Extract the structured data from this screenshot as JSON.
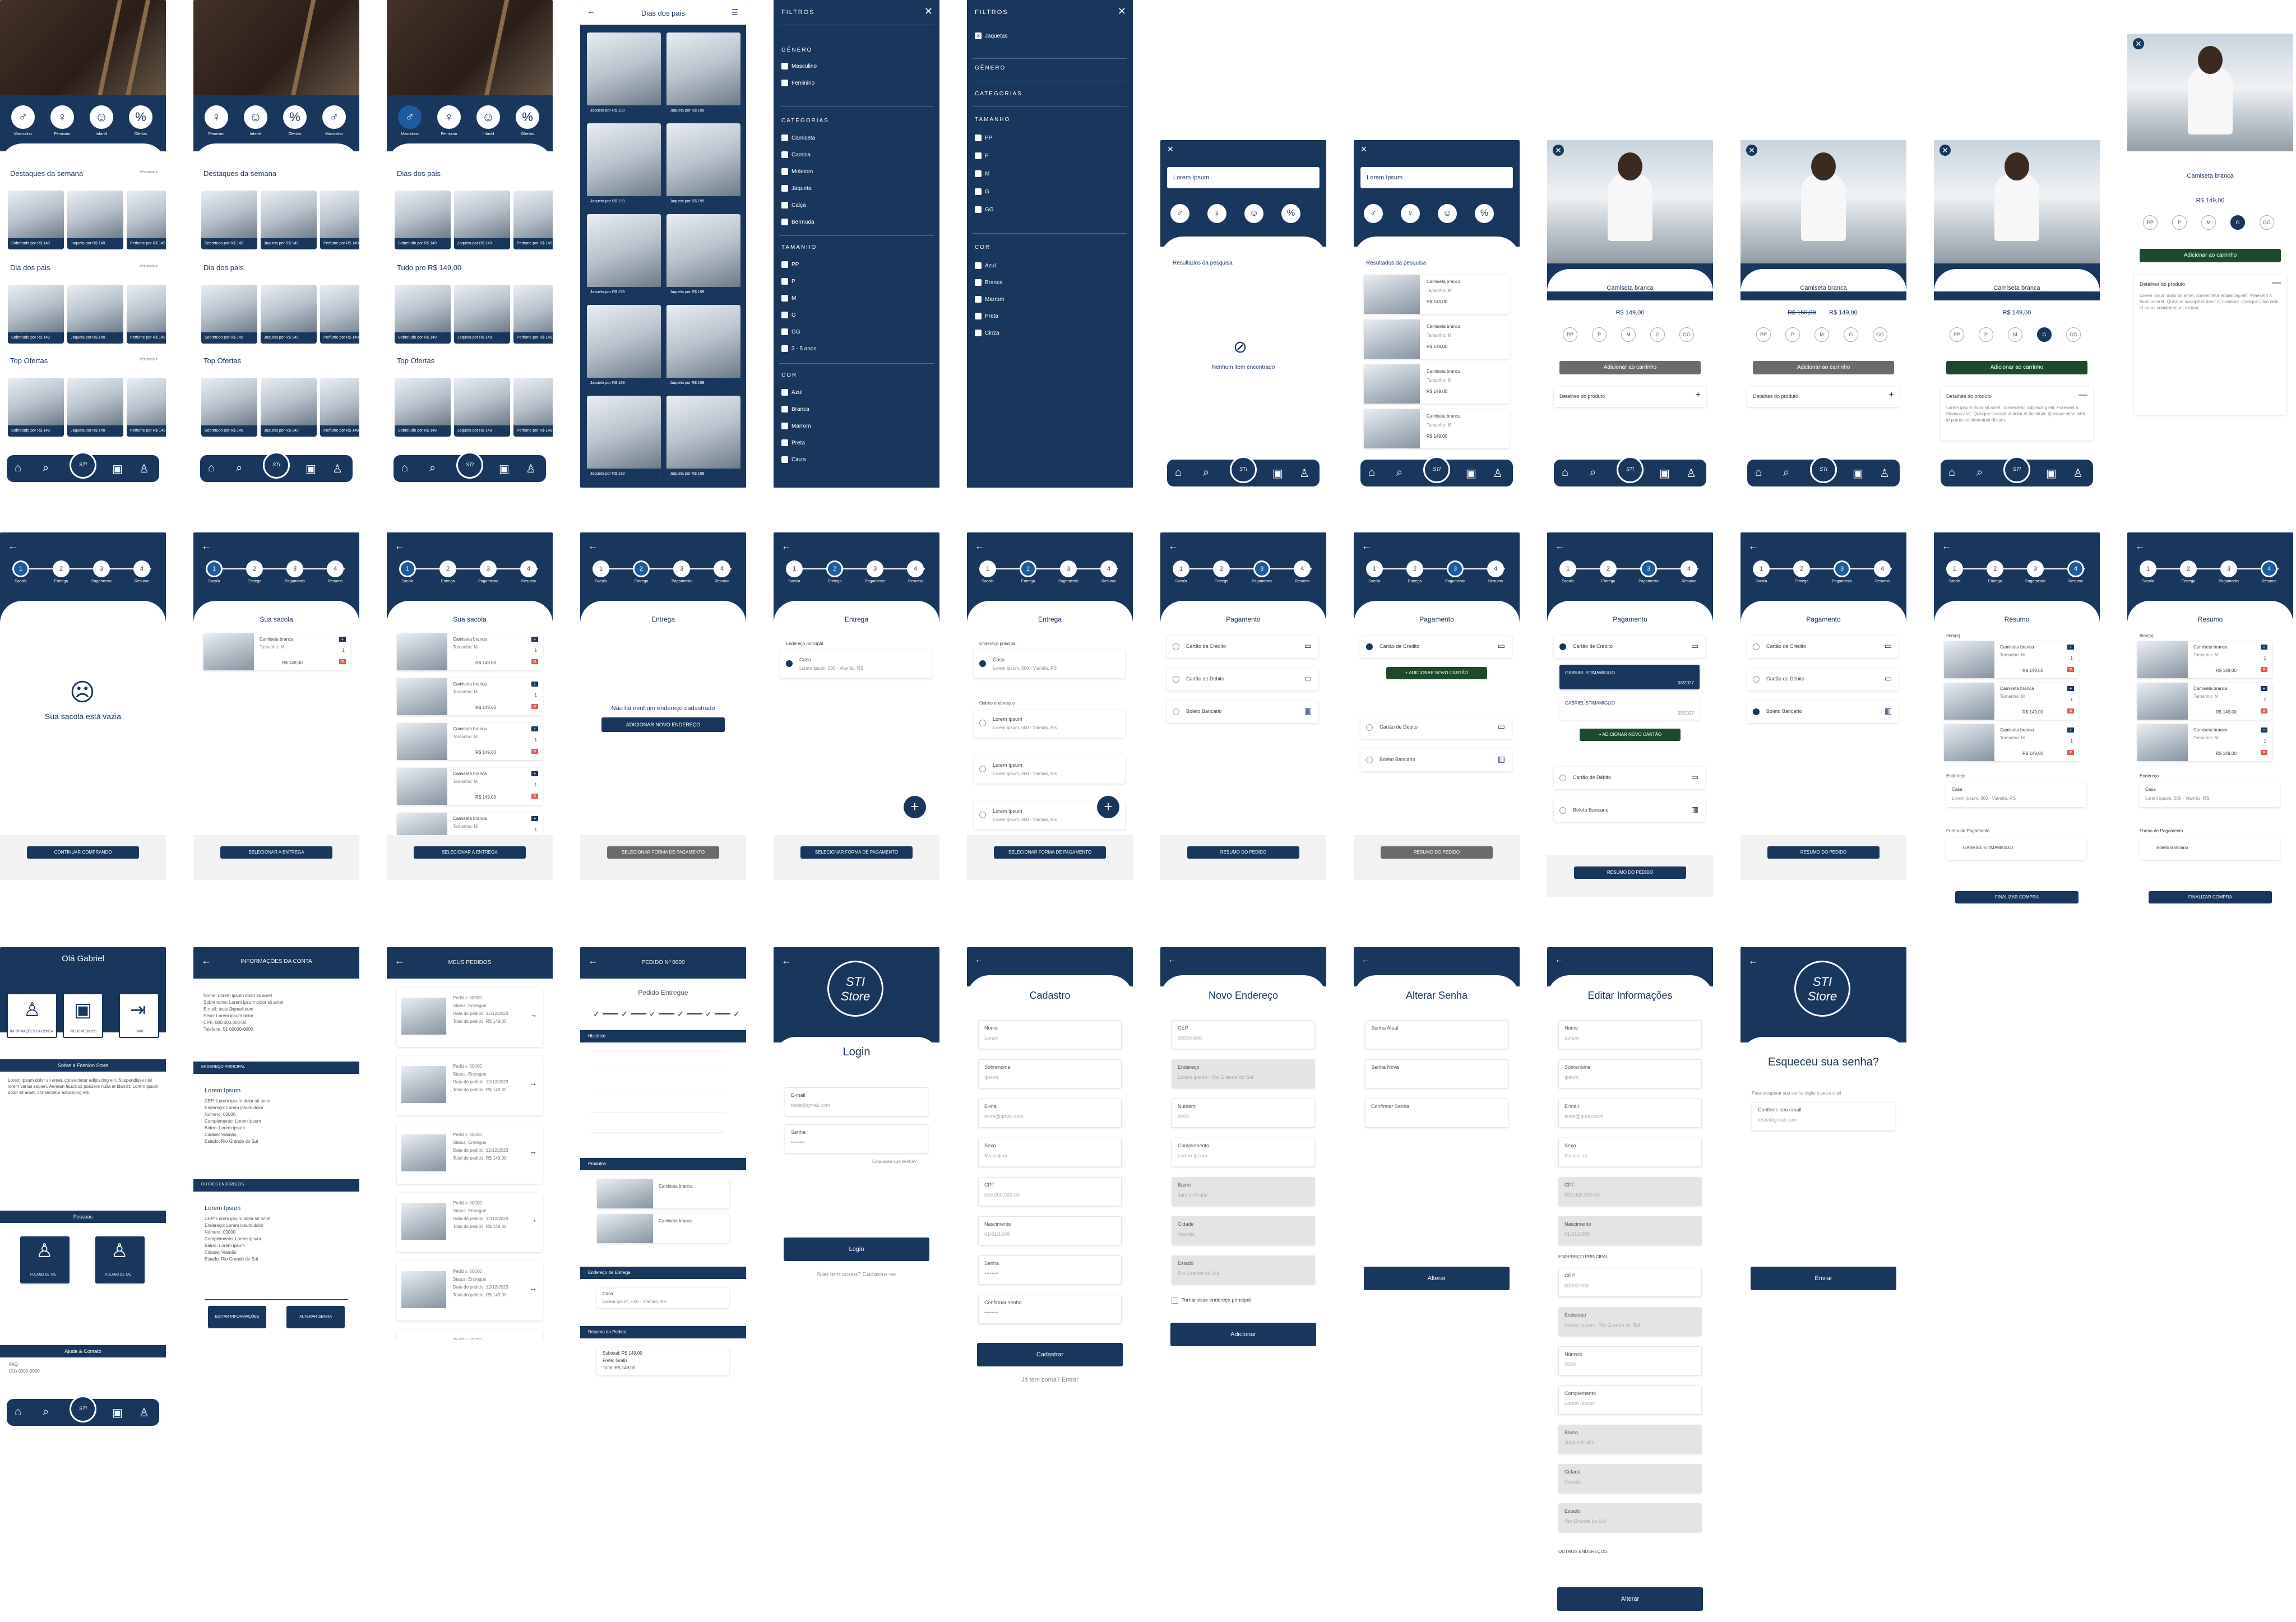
{
  "brand": {
    "logo_line1": "STI",
    "logo_line2": "Store"
  },
  "home": {
    "categories": [
      "Masculino",
      "Feminino",
      "Infantil",
      "Ofertas"
    ],
    "sections": [
      "Destaques da semana",
      "Dia dos pais",
      "Top Ofertas"
    ],
    "sections_b": [
      "Dias dos pais",
      "Tudo pro R$ 149,00",
      "Top Ofertas"
    ],
    "see_all": "Ver mais >",
    "product_captions": [
      "Sobretudo por R$ 149",
      "Jaqueta por R$ 149",
      "Perfume por R$ 149"
    ],
    "dots": "• • •"
  },
  "listing": {
    "title": "Dias dos pais",
    "caption": "Jaqueta por R$ 199"
  },
  "filters": {
    "title": "FILTROS",
    "genero": "GÊNERO",
    "genero_opts": [
      "Masculino",
      "Feminino"
    ],
    "categorias": "CATEGORIAS",
    "cat_opts": [
      "Camiseta",
      "Camisa",
      "Moletom",
      "Jaqueta",
      "Calça",
      "Bermuda"
    ],
    "tamanho": "TAMANHO",
    "size_opts": [
      "PP",
      "P",
      "M",
      "G",
      "GG",
      "3 - 5 anos"
    ],
    "cor": "COR",
    "color_opts": [
      "Azul",
      "Branca",
      "Marrom",
      "Preta",
      "Cinza"
    ],
    "selected": "Jaquetas"
  },
  "search": {
    "placeholder": "Lorem Ipsum",
    "results": "Resultados da pesquisa",
    "empty": "Nenhum item encontrado",
    "item_name": "Camiseta branca",
    "item_size": "Tamanho: M",
    "item_price": "R$ 149,00"
  },
  "product": {
    "name": "Camiseta branca",
    "price": "R$ 149,00",
    "old_price": "R$ 160,00",
    "sizes": [
      "PP",
      "P",
      "M",
      "G",
      "GG"
    ],
    "add": "Adicionar ao carrinho",
    "details": "Detalhes do produto",
    "desc": "Lorem ipsum dolor sit amet, consectetur adipiscing elit. Praesent a thoncus erat. Quisque suscipit et dolor et tincidunt. Quisque vitae nibh id purus condimentum dictum."
  },
  "checkout": {
    "steps": [
      "Sacola",
      "Entrega",
      "Pagamento",
      "Resumo"
    ],
    "empty_bag": "Sua sacola está vazia",
    "continue": "CONTINUAR COMPRANDO",
    "bag_title": "Sua sacola",
    "bag_item": "Camiseta branca",
    "bag_size": "Tamanho: M",
    "bag_qty": "1",
    "bag_price": "R$ 149,00",
    "to_delivery": "SELECIONAR A ENTREGA",
    "delivery_title": "Entrega",
    "no_address": "Não há nenhum endereço cadastrado",
    "add_address": "ADICIONAR NOVO ENDEREÇO",
    "main_address": "Endereço principal",
    "home": "Casa",
    "address": "Lorem Ipsum, 000 - Viamão, RS",
    "other_addresses": "Outros endereços",
    "other_name": "Lorem Ipsum",
    "to_payment": "SELECIONAR FORMA DE PAGAMENTO",
    "payment_title": "Pagamento",
    "credit": "Cartão de Crédito",
    "debit": "Cartão de Débito",
    "boleto": "Boleto Bancario",
    "add_card": "+ ADICIONAR NOVO CARTÃO",
    "card_holder": "GABRIEL STIMAMIGLIO",
    "card_exp": "03/2027",
    "to_summary": "RESUMO DO PEDIDO",
    "summary_title": "Resumo",
    "items": "Item(s)",
    "endereco": "Endereço",
    "forma": "Forma de Pagamento",
    "finish": "FINALIZAR COMPRA"
  },
  "account": {
    "hello": "Olá Gabriel",
    "tiles": [
      "INFORMAÇÕES DA CONTA",
      "MEUS PEDIDOS",
      "SAIR"
    ],
    "about_title": "Sobre a Fashion Store",
    "about_text": "Lorem ipsum dolor sit amet, consectetur adipiscing elit. Suspendisse nisi lorem varius sapien. Aenean faucibus posuere nulla at blandit. Lorem ipsum dolor sit amet, consectetur adipiscing elit.",
    "people": "Pessoas",
    "person": "FULANO DE TAL",
    "help": "Ajuda & Contato",
    "faq": "FAQ",
    "phone": "(51) 0000-0000"
  },
  "info": {
    "title": "INFORMAÇÕES DA CONTA",
    "lines": [
      "Nome: Lorem ipsum dolor sit amet",
      "Sobrenome: Lorem ipsum dolor sit amet",
      "E-mail: teste@gmail.com",
      "Sexo: Lorem ipsum dolor",
      "CPF: 000.000.000-00",
      "Telefone: 51 00000-0000"
    ],
    "main_address": "ENDEREÇO PRINCIPAL",
    "other_address": "OUTROS ENDEREÇOS",
    "addr_title": "Lorem Ipsum",
    "addr_lines": [
      "CEP: Lorem ipsum dolor sit amet",
      "Endereço: Lorem ipsum dolor",
      "Número: 00000",
      "Complemento: Lorem ipsum",
      "Bairro: Lorem ipsum",
      "Cidade: Viamão",
      "Estado: Rio Grande do Sul"
    ],
    "edit": "EDITAR INFORMAÇÕES",
    "change_pw": "ALTERAR SENHA"
  },
  "orders": {
    "title": "MEUS PEDIDOS",
    "lines": [
      "Pedido: 00000",
      "Status: Entregue",
      "Data do pedido: 12/12/2023",
      "Total do pedido: R$ 149,00"
    ]
  },
  "order": {
    "title": "PEDIDO Nº 0000",
    "status": "Pedido Entregue",
    "history": "Histórico",
    "products": "Produtos",
    "delivery": "Endereço de Entrega",
    "summary": "Resumo do Pedido",
    "totals": [
      "Subtotal: R$ 149,00",
      "Frete: Grátis",
      "Total: R$ 149,00"
    ]
  },
  "login": {
    "title": "Login",
    "email": "E-mail",
    "email_ph": "teste@gmail.com",
    "pw": "Senha",
    "forgot": "Esqueceu sua senha?",
    "btn": "Login",
    "no_account": "Não tem conta? Cadastre-se"
  },
  "signup": {
    "title": "Cadastro",
    "fields": [
      "Nome",
      "Sobrenome",
      "E-mail",
      "Sexo",
      "CPF",
      "Nascimento",
      "Senha",
      "Confirmar senha"
    ],
    "values": [
      "Lorem",
      "Ipsum",
      "teste@gmail.com",
      "Masculino",
      "000.000.000-00",
      "01/01/1998",
      "••••••••",
      "••••••••"
    ],
    "btn": "Cadastrar",
    "have": "Já tem conta? Entrar"
  },
  "new_address": {
    "title": "Novo Endereço",
    "fields": [
      "CEP",
      "Endereço",
      "Número",
      "Complemento",
      "Bairro",
      "Cidade",
      "Estado"
    ],
    "values": [
      "00000-000",
      "Lorem Ipsum - Rio Grande do Sul",
      "0000",
      "Lorem Ipsum",
      "Jardim Krahe",
      "Viamão",
      "Rio Grande do Sul"
    ],
    "main": "Tornar esse endereço principal",
    "btn": "Adicionar"
  },
  "change_pw": {
    "title": "Alterar Senha",
    "fields": [
      "Senha Atual",
      "Senha Nova",
      "Confirmar Senha"
    ],
    "btn": "Alterar"
  },
  "edit_info": {
    "title": "Editar Informações",
    "fields": [
      "Nome",
      "Sobrenome",
      "E-mail",
      "Sexo",
      "CPF",
      "Nascimento"
    ],
    "values": [
      "Lorem",
      "Ipsum",
      "teste@gmail.com",
      "Masculino",
      "000.000.000-00",
      "01/01/1998"
    ],
    "main_addr": "ENDEREÇO PRINCIPAL",
    "addr_fields": [
      "CEP",
      "Endereço",
      "Número",
      "Complemento",
      "Bairro",
      "Cidade",
      "Estado"
    ],
    "addr_values": [
      "00000-000",
      "Lorem Ipsum - Rio Grande do Sul",
      "0000",
      "Lorem Ipsum",
      "Jardim Krahe",
      "Viamão",
      "Rio Grande do Sul"
    ],
    "others": "OUTROS ENDEREÇOS",
    "btn": "Alterar"
  },
  "forgot": {
    "title": "Esqueceu sua senha?",
    "hint": "Para recuperar sua senha digite o seu e-mail",
    "field": "Confirme seu email",
    "value": "teste@gmail.com",
    "btn": "Enviar"
  },
  "colors": {
    "navy": "#19365c",
    "gray": "#6b6b6b",
    "green": "#1c4a2a",
    "danger": "#e05a5a"
  }
}
